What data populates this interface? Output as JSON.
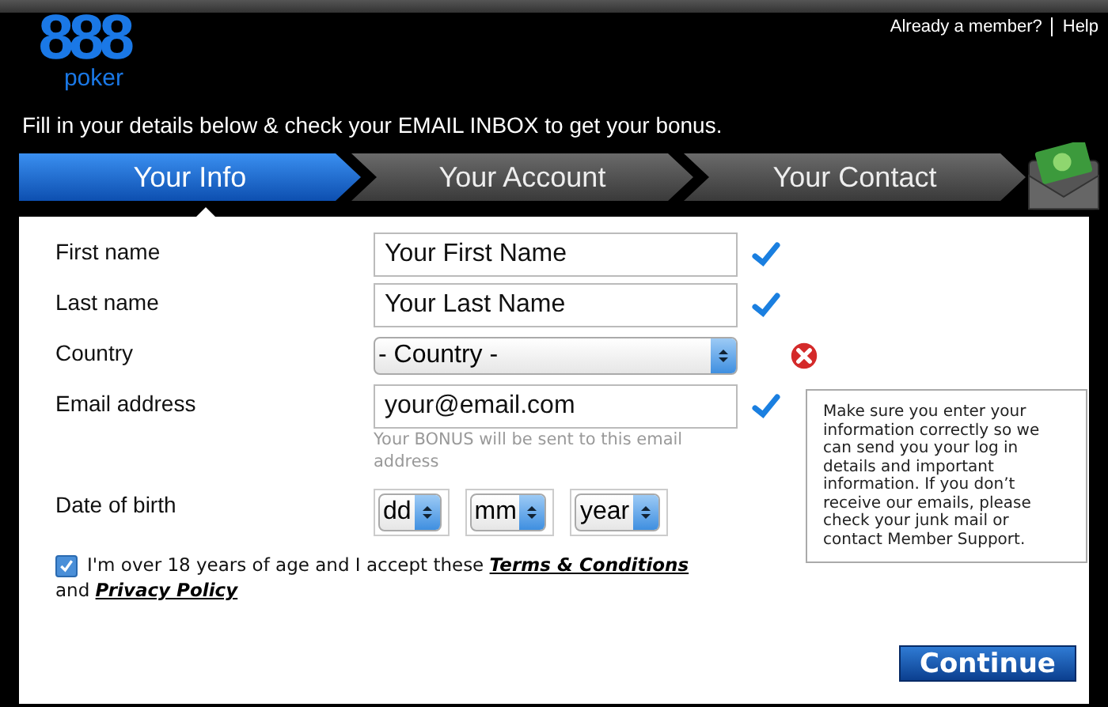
{
  "header": {
    "logo_number": "888",
    "logo_word": "poker",
    "links": [
      "Already a member?",
      "Help"
    ]
  },
  "instruction": "Fill in your details below & check your EMAIL INBOX to get your bonus.",
  "steps": [
    {
      "label": "Your Info",
      "selected": true
    },
    {
      "label": "Your Account",
      "selected": false
    },
    {
      "label": "Your Contact",
      "selected": false
    }
  ],
  "fields": [
    {
      "label": "First name",
      "kind": "text",
      "value": "Your First Name",
      "valid": true
    },
    {
      "label": "Last name",
      "kind": "text",
      "value": "Your Last Name",
      "valid": true
    },
    {
      "label": "Country",
      "kind": "select",
      "value": "- Country -",
      "valid": false
    },
    {
      "label": "Email address",
      "kind": "text",
      "value": "your@email.com",
      "valid": true,
      "hint": "Your BONUS will be sent to this email address"
    },
    {
      "label": "Date of birth",
      "kind": "date",
      "parts": [
        "dd",
        "mm",
        "year"
      ]
    }
  ],
  "tooltip": "Make sure you enter your information correctly so we can send you your log in details and important information. If you don’t receive our emails, please check your junk mail or contact Member Support.",
  "agreement": {
    "checked": true,
    "text": "I'm over 18 years of age and I accept these",
    "terms_link": "Terms & Conditions",
    "joiner": "and",
    "privacy_link": "Privacy Policy"
  },
  "continue_button": "Continue"
}
